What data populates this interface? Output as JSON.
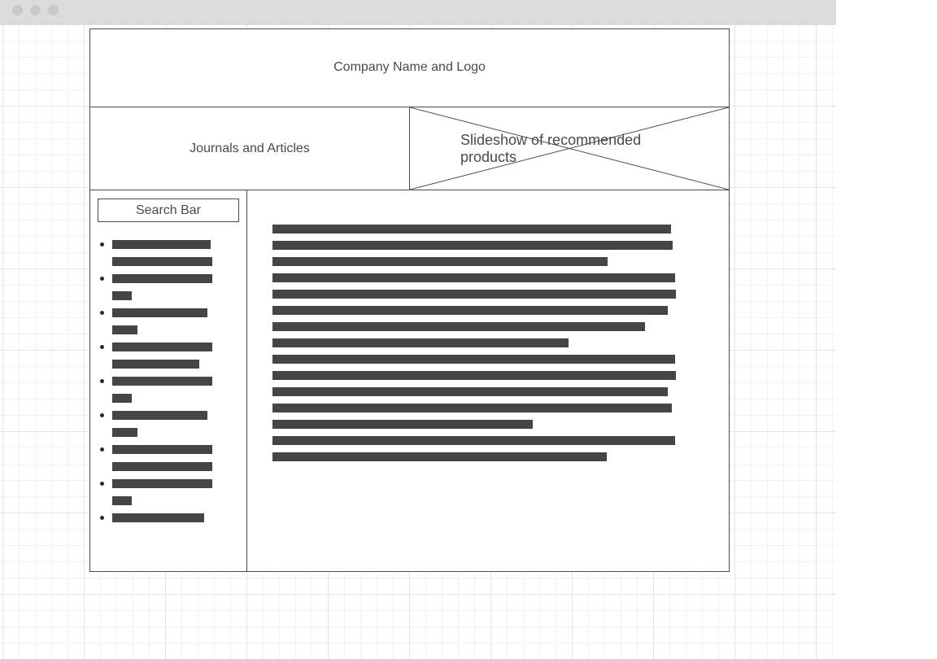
{
  "window": {
    "controls": [
      "close-dot",
      "minimize-dot",
      "maximize-dot"
    ]
  },
  "header": {
    "title": "Company Name and Logo"
  },
  "nav": {
    "journals_label": "Journals and Articles"
  },
  "slideshow": {
    "label": "Slideshow of recommended products",
    "image_placeholder": "x-cross-placeholder"
  },
  "sidebar": {
    "search_label": "Search Bar",
    "list_item_count": 9
  },
  "main": {
    "paragraph_line_count": 15
  },
  "colors": {
    "wire": "#4a4a4a",
    "bar": "#454545",
    "titlebar": "#dcdcdc"
  }
}
